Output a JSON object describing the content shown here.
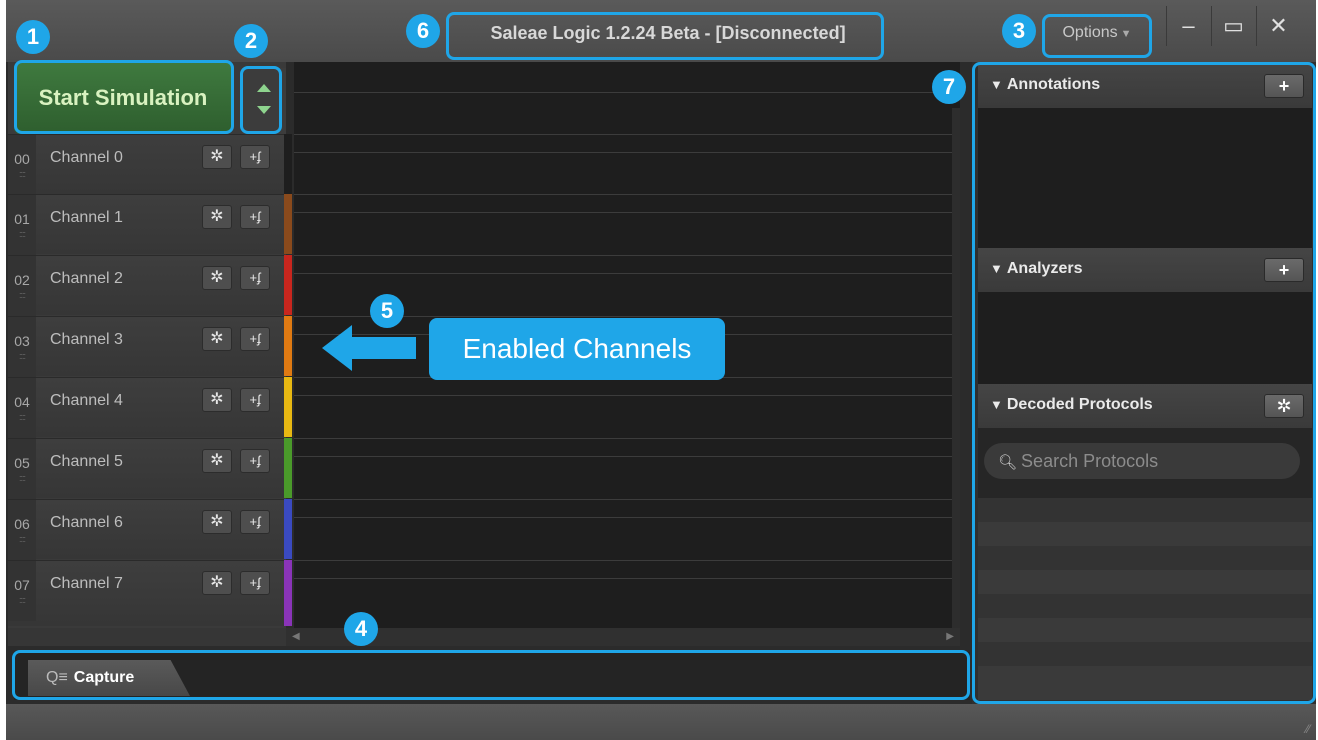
{
  "window": {
    "title": "Saleae Logic 1.2.24 Beta - [Disconnected]",
    "options_label": "Options",
    "minimize_glyph": "–",
    "maximize_glyph": "▭",
    "close_glyph": "✕"
  },
  "toolbar": {
    "start_label": "Start Simulation"
  },
  "channels": [
    {
      "num": "00",
      "name": "Channel 0",
      "color": "#1e1e1e"
    },
    {
      "num": "01",
      "name": "Channel 1",
      "color": "#8a4a1c"
    },
    {
      "num": "02",
      "name": "Channel 2",
      "color": "#c8261e"
    },
    {
      "num": "03",
      "name": "Channel 3",
      "color": "#e07a12"
    },
    {
      "num": "04",
      "name": "Channel 4",
      "color": "#e8b812"
    },
    {
      "num": "05",
      "name": "Channel 5",
      "color": "#4a9a2a"
    },
    {
      "num": "06",
      "name": "Channel 6",
      "color": "#3a4ac0"
    },
    {
      "num": "07",
      "name": "Channel 7",
      "color": "#8a34b8"
    }
  ],
  "channel_buttons": {
    "gear_glyph": "✲",
    "trigger_glyph": "+ʄ"
  },
  "tabs": {
    "capture_label": "Capture"
  },
  "right_panel": {
    "annotations_title": "Annotations",
    "analyzers_title": "Analyzers",
    "decoded_title": "Decoded Protocols",
    "search_placeholder": "Search Protocols",
    "add_glyph": "+",
    "gear_glyph": "✲"
  },
  "overlay": {
    "enabled_channels_label": "Enabled Channels",
    "badges": [
      "1",
      "2",
      "3",
      "4",
      "5",
      "6",
      "7"
    ],
    "accent_color": "#1fa6e8"
  }
}
